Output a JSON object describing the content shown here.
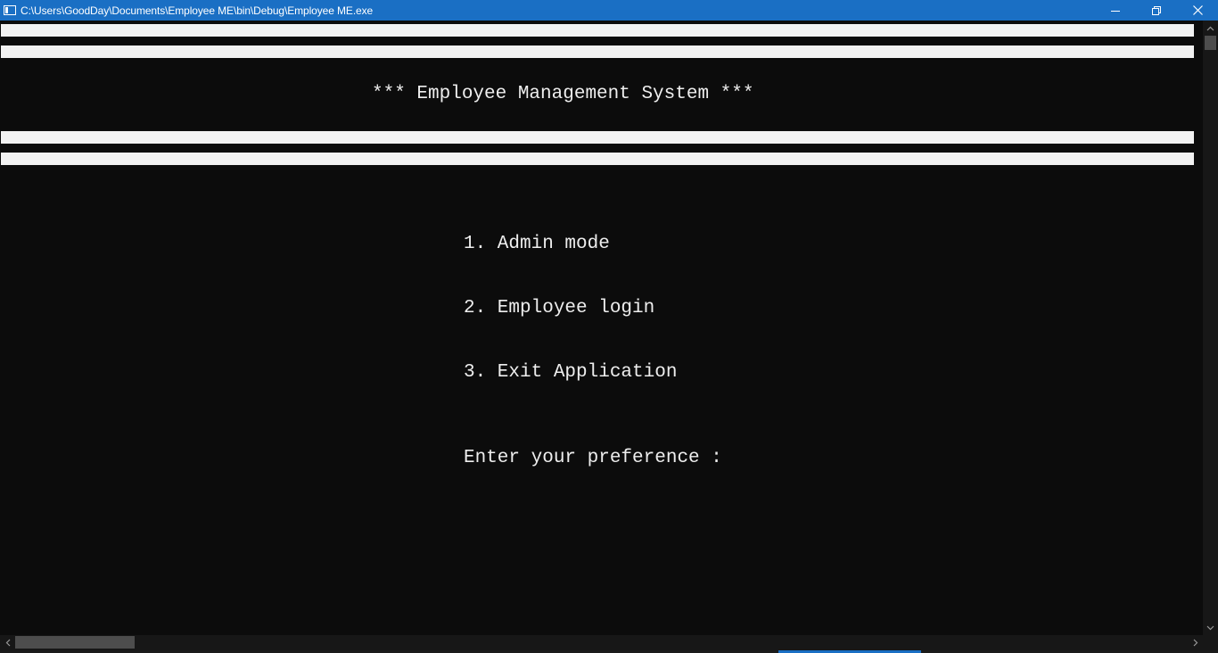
{
  "window": {
    "title": "C:\\Users\\GoodDay\\Documents\\Employee ME\\bin\\Debug\\Employee ME.exe",
    "titlebar_color": "#1a6fc4",
    "buttons": {
      "minimize": "minimize-icon",
      "restore": "restore-icon",
      "close": "close-icon"
    }
  },
  "console": {
    "background": "#0c0c0c",
    "foreground": "#eeeeee",
    "heading": "*** Employee Management System ***",
    "menu": [
      {
        "label": "1. Admin mode"
      },
      {
        "label": "2. Employee login"
      },
      {
        "label": "3. Exit Application"
      }
    ],
    "prompt": "Enter your preference :"
  }
}
